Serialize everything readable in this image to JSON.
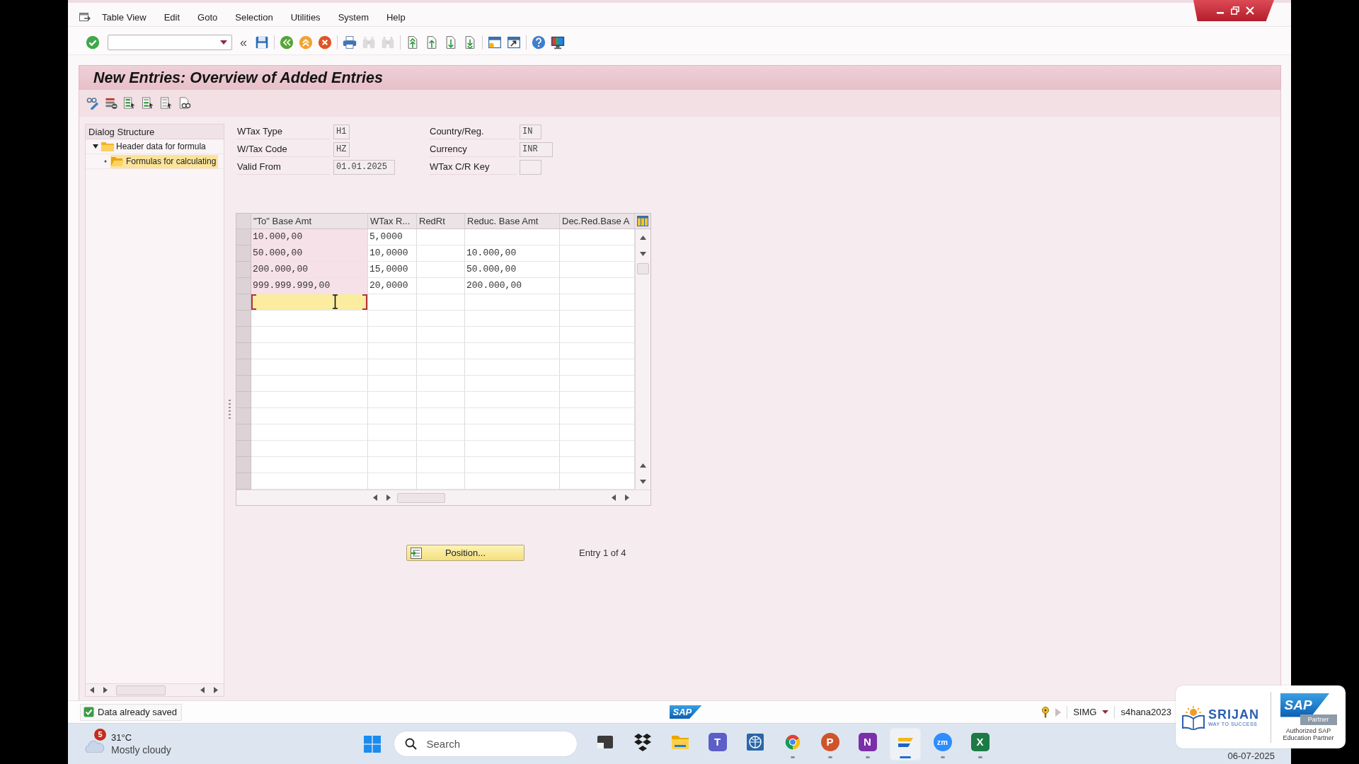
{
  "menu": [
    "Table View",
    "Edit",
    "Goto",
    "Selection",
    "Utilities",
    "System",
    "Help"
  ],
  "toolbar": {
    "groups": [
      {
        "items": [
          {
            "kind": "enter",
            "disabled": false
          },
          {
            "kind": "command_field",
            "disabled": false
          },
          {
            "kind": "collapse",
            "glyph": "«",
            "disabled": false
          },
          {
            "kind": "save",
            "disabled": false
          }
        ]
      },
      {
        "items": [
          {
            "kind": "back",
            "disabled": false
          },
          {
            "kind": "exit",
            "disabled": false
          },
          {
            "kind": "cancel",
            "disabled": false
          }
        ]
      },
      {
        "items": [
          {
            "kind": "print",
            "disabled": false
          },
          {
            "kind": "find",
            "disabled": true
          },
          {
            "kind": "find_next",
            "disabled": true
          }
        ]
      },
      {
        "items": [
          {
            "kind": "first_page",
            "disabled": false
          },
          {
            "kind": "previous_page",
            "disabled": false
          },
          {
            "kind": "next_page",
            "disabled": false
          },
          {
            "kind": "last_page",
            "disabled": false
          }
        ]
      },
      {
        "items": [
          {
            "kind": "new_session",
            "disabled": false
          },
          {
            "kind": "shortcut",
            "disabled": false
          }
        ]
      },
      {
        "items": [
          {
            "kind": "help",
            "disabled": false
          },
          {
            "kind": "layout",
            "disabled": false
          }
        ]
      }
    ]
  },
  "title": "New Entries: Overview of Added Entries",
  "app_toolbar": [
    {
      "kind": "display_change"
    },
    {
      "kind": "delete_row"
    },
    {
      "kind": "select_all"
    },
    {
      "kind": "select_block"
    },
    {
      "kind": "deselect_all"
    },
    {
      "kind": "print_view"
    }
  ],
  "dialog_structure": {
    "title": "Dialog Structure",
    "items": [
      {
        "label": "Header data for formula",
        "expanded": true,
        "selected": false,
        "children": [
          {
            "label": "Formulas for calculating",
            "selected": true
          }
        ]
      }
    ]
  },
  "header": {
    "groups": [
      {
        "fields": [
          {
            "label": "WTax Type",
            "value": "H1"
          },
          {
            "label": "W/Tax Code",
            "value": "HZ"
          },
          {
            "label": "Valid From",
            "value": "01.01.2025"
          }
        ]
      },
      {
        "fields": [
          {
            "label": "Country/Reg.",
            "value": "IN"
          },
          {
            "label": "Currency",
            "value": "INR"
          },
          {
            "label": "WTax C/R Key"
          }
        ]
      }
    ]
  },
  "table": {
    "columns": [
      "\"To\" Base Amt",
      "WTax R...",
      "RedRt",
      "Reduc. Base Amt",
      "Dec.Red.Base A"
    ],
    "rows": [
      {
        "to_base_amt": "10.000,00",
        "wtax_r": "5,0000"
      },
      {
        "to_base_amt": "50.000,00",
        "wtax_r": "10,0000",
        "reduc_base_amt": "10.000,00"
      },
      {
        "to_base_amt": "200.000,00",
        "wtax_r": "15,0000",
        "reduc_base_amt": "50.000,00"
      },
      {
        "to_base_amt": "999.999.999,00",
        "wtax_r": "20,0000",
        "reduc_base_amt": "200.000,00"
      }
    ],
    "new_entry": {
      "focused": true
    }
  },
  "position_button": {
    "label": "Position..."
  },
  "entry_info": "Entry 1 of 4",
  "status_bar": {
    "message": {
      "kind": "success",
      "text": "Data already saved"
    },
    "logo": "SAP",
    "system": "SIMG",
    "server": "s4hana2023"
  },
  "taskbar": {
    "weather": {
      "badge": "5",
      "temperature": "31°C",
      "condition": "Mostly cloudy"
    },
    "search": {
      "placeholder": "Search"
    },
    "apps": [
      {
        "kind": "dark_tile",
        "running": false,
        "selected": false
      },
      {
        "kind": "diamond_pattern",
        "running": false,
        "selected": false
      },
      {
        "kind": "folder",
        "running": false,
        "selected": false
      },
      {
        "kind": "people_tile",
        "glyph": "T",
        "running": false,
        "selected": false
      },
      {
        "kind": "globe_tile",
        "running": false,
        "selected": false
      },
      {
        "kind": "tricolor_circle",
        "running": true,
        "selected": false
      },
      {
        "kind": "presentation",
        "glyph": "P",
        "running": true,
        "selected": false
      },
      {
        "kind": "notebook",
        "glyph": "N",
        "running": true,
        "selected": false
      },
      {
        "kind": "slanted_bars",
        "running": true,
        "selected": true
      },
      {
        "kind": "video_meeting",
        "glyph": "zm",
        "running": true,
        "selected": false
      },
      {
        "kind": "spreadsheet",
        "glyph": "X",
        "running": true,
        "selected": false
      }
    ],
    "date": "06-07-2025"
  },
  "overlay_badge": {
    "brand": "SRIJAN",
    "tagline": "WAY TO SUCCESS",
    "partner_logo": "SAP",
    "partner_tag": "Partner",
    "partner_note": "Authorized SAP Education Partner"
  }
}
